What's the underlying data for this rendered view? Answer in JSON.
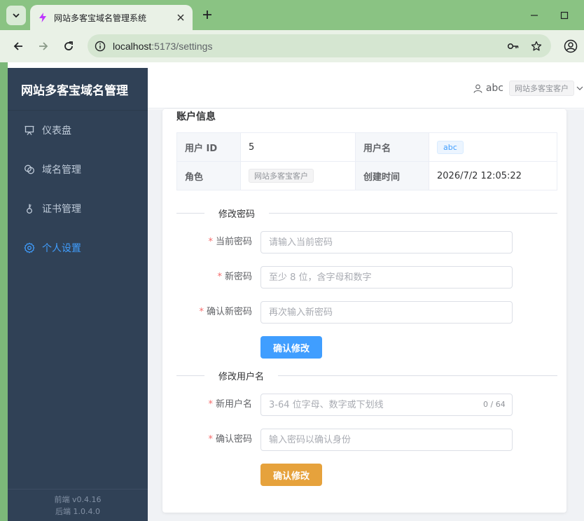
{
  "browser": {
    "tab_title": "网站多客宝域名管理系统",
    "url_host": "localhost",
    "url_rest": ":5173/settings"
  },
  "sidebar": {
    "brand": "网站多客宝域名管理",
    "items": [
      {
        "label": "仪表盘",
        "icon": "dashboard-icon",
        "active": false
      },
      {
        "label": "域名管理",
        "icon": "link-icon",
        "active": false
      },
      {
        "label": "证书管理",
        "icon": "certificate-icon",
        "active": false
      },
      {
        "label": "个人设置",
        "icon": "gear-icon",
        "active": true
      }
    ],
    "frontend_version": "前端 v0.4.16",
    "backend_version": "后端 1.0.4.0"
  },
  "header": {
    "username": "abc",
    "role": "网站多客宝客户"
  },
  "account": {
    "title": "账户信息",
    "user_id_label": "用户 ID",
    "user_id": "5",
    "username_label": "用户名",
    "username": "abc",
    "role_label": "角色",
    "role": "网站多客宝客户",
    "created_label": "创建时间",
    "created": "2026/7/2 12:05:22"
  },
  "password_form": {
    "title": "修改密码",
    "current_label": "当前密码",
    "current_placeholder": "请输入当前密码",
    "new_label": "新密码",
    "new_placeholder": "至少 8 位，含字母和数字",
    "confirm_label": "确认新密码",
    "confirm_placeholder": "再次输入新密码",
    "submit_label": "确认修改"
  },
  "username_form": {
    "title": "修改用户名",
    "new_label": "新用户名",
    "new_placeholder": "3-64 位字母、数字或下划线",
    "counter": "0 / 64",
    "password_label": "确认密码",
    "password_placeholder": "输入密码以确认身份",
    "submit_label": "确认修改"
  },
  "colors": {
    "primary": "#409eff",
    "warning": "#e6a23c",
    "sidebar_bg": "#304156",
    "required": "#f56c6c"
  }
}
